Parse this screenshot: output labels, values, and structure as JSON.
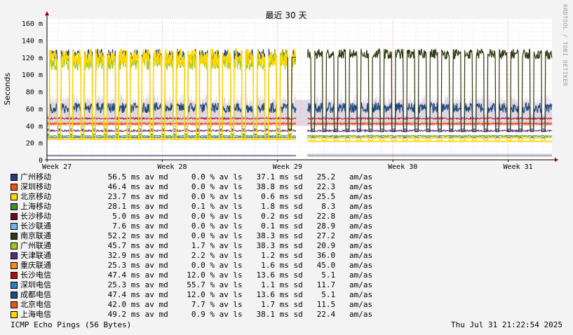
{
  "chart_data": {
    "type": "line",
    "title": "最近 30 天",
    "ylabel": "Seconds",
    "ylim": [
      0,
      0.165
    ],
    "yticks": [
      {
        "v": 0,
        "label": "0"
      },
      {
        "v": 0.02,
        "label": "20 m"
      },
      {
        "v": 0.04,
        "label": "40 m"
      },
      {
        "v": 0.06,
        "label": "60 m"
      },
      {
        "v": 0.08,
        "label": "80 m"
      },
      {
        "v": 0.1,
        "label": "100 m"
      },
      {
        "v": 0.12,
        "label": "120 m"
      },
      {
        "v": 0.14,
        "label": "140 m"
      },
      {
        "v": 0.16,
        "label": "160 m"
      }
    ],
    "xlim": [
      0,
      43.8
    ],
    "xticks": [
      {
        "v": 0,
        "label": "Week 27"
      },
      {
        "v": 10,
        "label": "Week 28"
      },
      {
        "v": 20,
        "label": "Week 29"
      },
      {
        "v": 30,
        "label": "Week 30"
      },
      {
        "v": 40,
        "label": "Week 31"
      }
    ],
    "gap": [
      21.6,
      22.6
    ],
    "grid": true,
    "series": [
      {
        "name": "广州移动",
        "color": "#1F3D78",
        "median_ms": "56.5",
        "avg_ls": "0.0",
        "sd_ms": "37.1",
        "am_as": "25.2"
      },
      {
        "name": "深圳移动",
        "color": "#F0521B",
        "median_ms": "46.4",
        "avg_ls": "0.0",
        "sd_ms": "38.8",
        "am_as": "22.3"
      },
      {
        "name": "北京移动",
        "color": "#FFD700",
        "median_ms": "23.7",
        "avg_ls": "0.0",
        "sd_ms": "0.6",
        "am_as": "25.5"
      },
      {
        "name": "上海移动",
        "color": "#3C8F2A",
        "median_ms": "28.1",
        "avg_ls": "0.1",
        "sd_ms": "1.8",
        "am_as": "8.3"
      },
      {
        "name": "长沙移动",
        "color": "#6B0A1E",
        "median_ms": "5.0",
        "avg_ls": "0.0",
        "sd_ms": "0.2",
        "am_as": "22.8"
      },
      {
        "name": "长沙联通",
        "color": "#6EB5F0",
        "median_ms": "7.6",
        "avg_ls": "0.0",
        "sd_ms": "0.1",
        "am_as": "28.9"
      },
      {
        "name": "南京联通",
        "color": "#2F3A0F",
        "median_ms": "52.2",
        "avg_ls": "0.0",
        "sd_ms": "38.3",
        "am_as": "27.2"
      },
      {
        "name": "广州联通",
        "color": "#A5C81E",
        "median_ms": "45.7",
        "avg_ls": "1.7",
        "sd_ms": "38.3",
        "am_as": "20.9"
      },
      {
        "name": "天津联通",
        "color": "#5A2A80",
        "median_ms": "32.9",
        "avg_ls": "2.2",
        "sd_ms": "1.2",
        "am_as": "36.0"
      },
      {
        "name": "重庆联通",
        "color": "#F58A1F",
        "median_ms": "25.3",
        "avg_ls": "0.0",
        "sd_ms": "1.6",
        "am_as": "45.0"
      },
      {
        "name": "长沙电信",
        "color": "#B01010",
        "median_ms": "47.4",
        "avg_ls": "12.0",
        "sd_ms": "13.6",
        "am_as": "5.1"
      },
      {
        "name": "深圳电信",
        "color": "#2E7FC2",
        "median_ms": "25.3",
        "avg_ls": "55.7",
        "sd_ms": "1.1",
        "am_as": "11.7"
      },
      {
        "name": "成都电信",
        "color": "#1E4A80",
        "median_ms": "47.4",
        "avg_ls": "12.0",
        "sd_ms": "13.6",
        "am_as": "5.1"
      },
      {
        "name": "北京电信",
        "color": "#F0521B",
        "median_ms": "42.0",
        "avg_ls": "7.7",
        "sd_ms": "1.7",
        "am_as": "11.5"
      },
      {
        "name": "上海电信",
        "color": "#FFD700",
        "median_ms": "49.2",
        "avg_ls": "0.9",
        "sd_ms": "38.1",
        "am_as": "22.4"
      }
    ],
    "legend_units": {
      "median": "ms av md",
      "loss": "% av ls",
      "sd": "ms sd",
      "asn": "am/as"
    }
  },
  "footer": {
    "left": "ICMP Echo Pings (56 Bytes)",
    "right": "Thu Jul 31 21:22:54 2025"
  },
  "watermark": "RRDTOOL / TOBI OETIKER"
}
